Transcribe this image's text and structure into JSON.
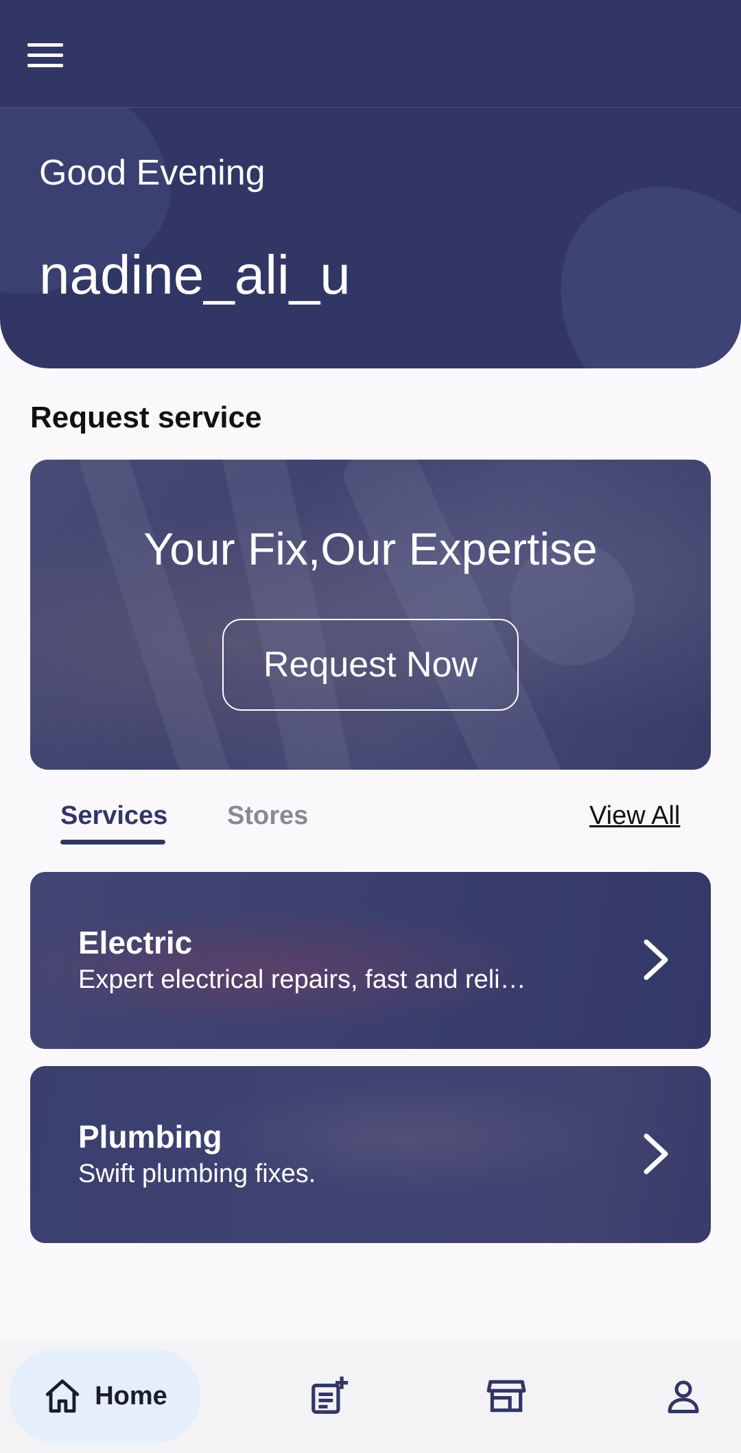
{
  "header": {
    "greeting": "Good Evening",
    "username": "nadine_ali_u"
  },
  "request_service": {
    "title": "Request service",
    "banner_title": "Your Fix,Our Expertise",
    "button_label": "Request Now"
  },
  "tabs": {
    "items": [
      {
        "label": "Services",
        "selected": true
      },
      {
        "label": "Stores",
        "selected": false
      }
    ],
    "view_all": "View All"
  },
  "services": [
    {
      "title": "Electric",
      "description": "Expert electrical repairs, fast and reli…"
    },
    {
      "title": "Plumbing",
      "description": "Swift plumbing fixes."
    }
  ],
  "bottom_nav": {
    "items": [
      {
        "label": "Home",
        "icon": "home-icon",
        "selected": true
      },
      {
        "label": "",
        "icon": "add-request-icon",
        "selected": false
      },
      {
        "label": "",
        "icon": "store-icon",
        "selected": false
      },
      {
        "label": "",
        "icon": "profile-icon",
        "selected": false
      }
    ]
  },
  "colors": {
    "primary": "#323664",
    "background": "#fbf8fc",
    "nav_selected_pill": "#e5eefb",
    "tab_inactive": "#8a8a8e"
  }
}
